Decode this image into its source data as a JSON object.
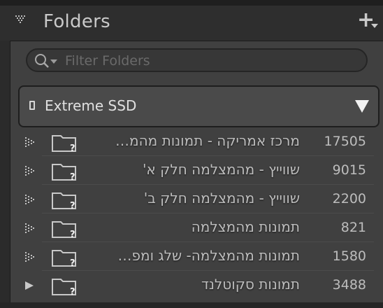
{
  "header": {
    "title": "Folders",
    "add_icon": "plus-with-caret"
  },
  "search": {
    "placeholder": "Filter Folders",
    "value": ""
  },
  "volume": {
    "name": "Extreme SSD",
    "icon": "drive-icon",
    "expanded": true
  },
  "folders": [
    {
      "name": "מרכז אמריקה - תמונות מהמ…",
      "count": "17505",
      "expander": "dotted"
    },
    {
      "name": "שווייץ - מהמצלמה חלק א'",
      "count": "9015",
      "expander": "dotted"
    },
    {
      "name": "שווייץ - מהמצלמה חלק ב'",
      "count": "2200",
      "expander": "dotted"
    },
    {
      "name": "תמונות מהמצלמה",
      "count": "821",
      "expander": "dotted"
    },
    {
      "name": "תמונות מהמצלמה- שלג ומפ…",
      "count": "1580",
      "expander": "dotted"
    },
    {
      "name": "תמונות סקוטלנד",
      "count": "3488",
      "expander": "solid"
    }
  ],
  "colors": {
    "panel_bg": "#404040",
    "header_bg": "#2e2e2e",
    "text": "#bdbdbd",
    "accent_white": "#f2f2f2"
  }
}
